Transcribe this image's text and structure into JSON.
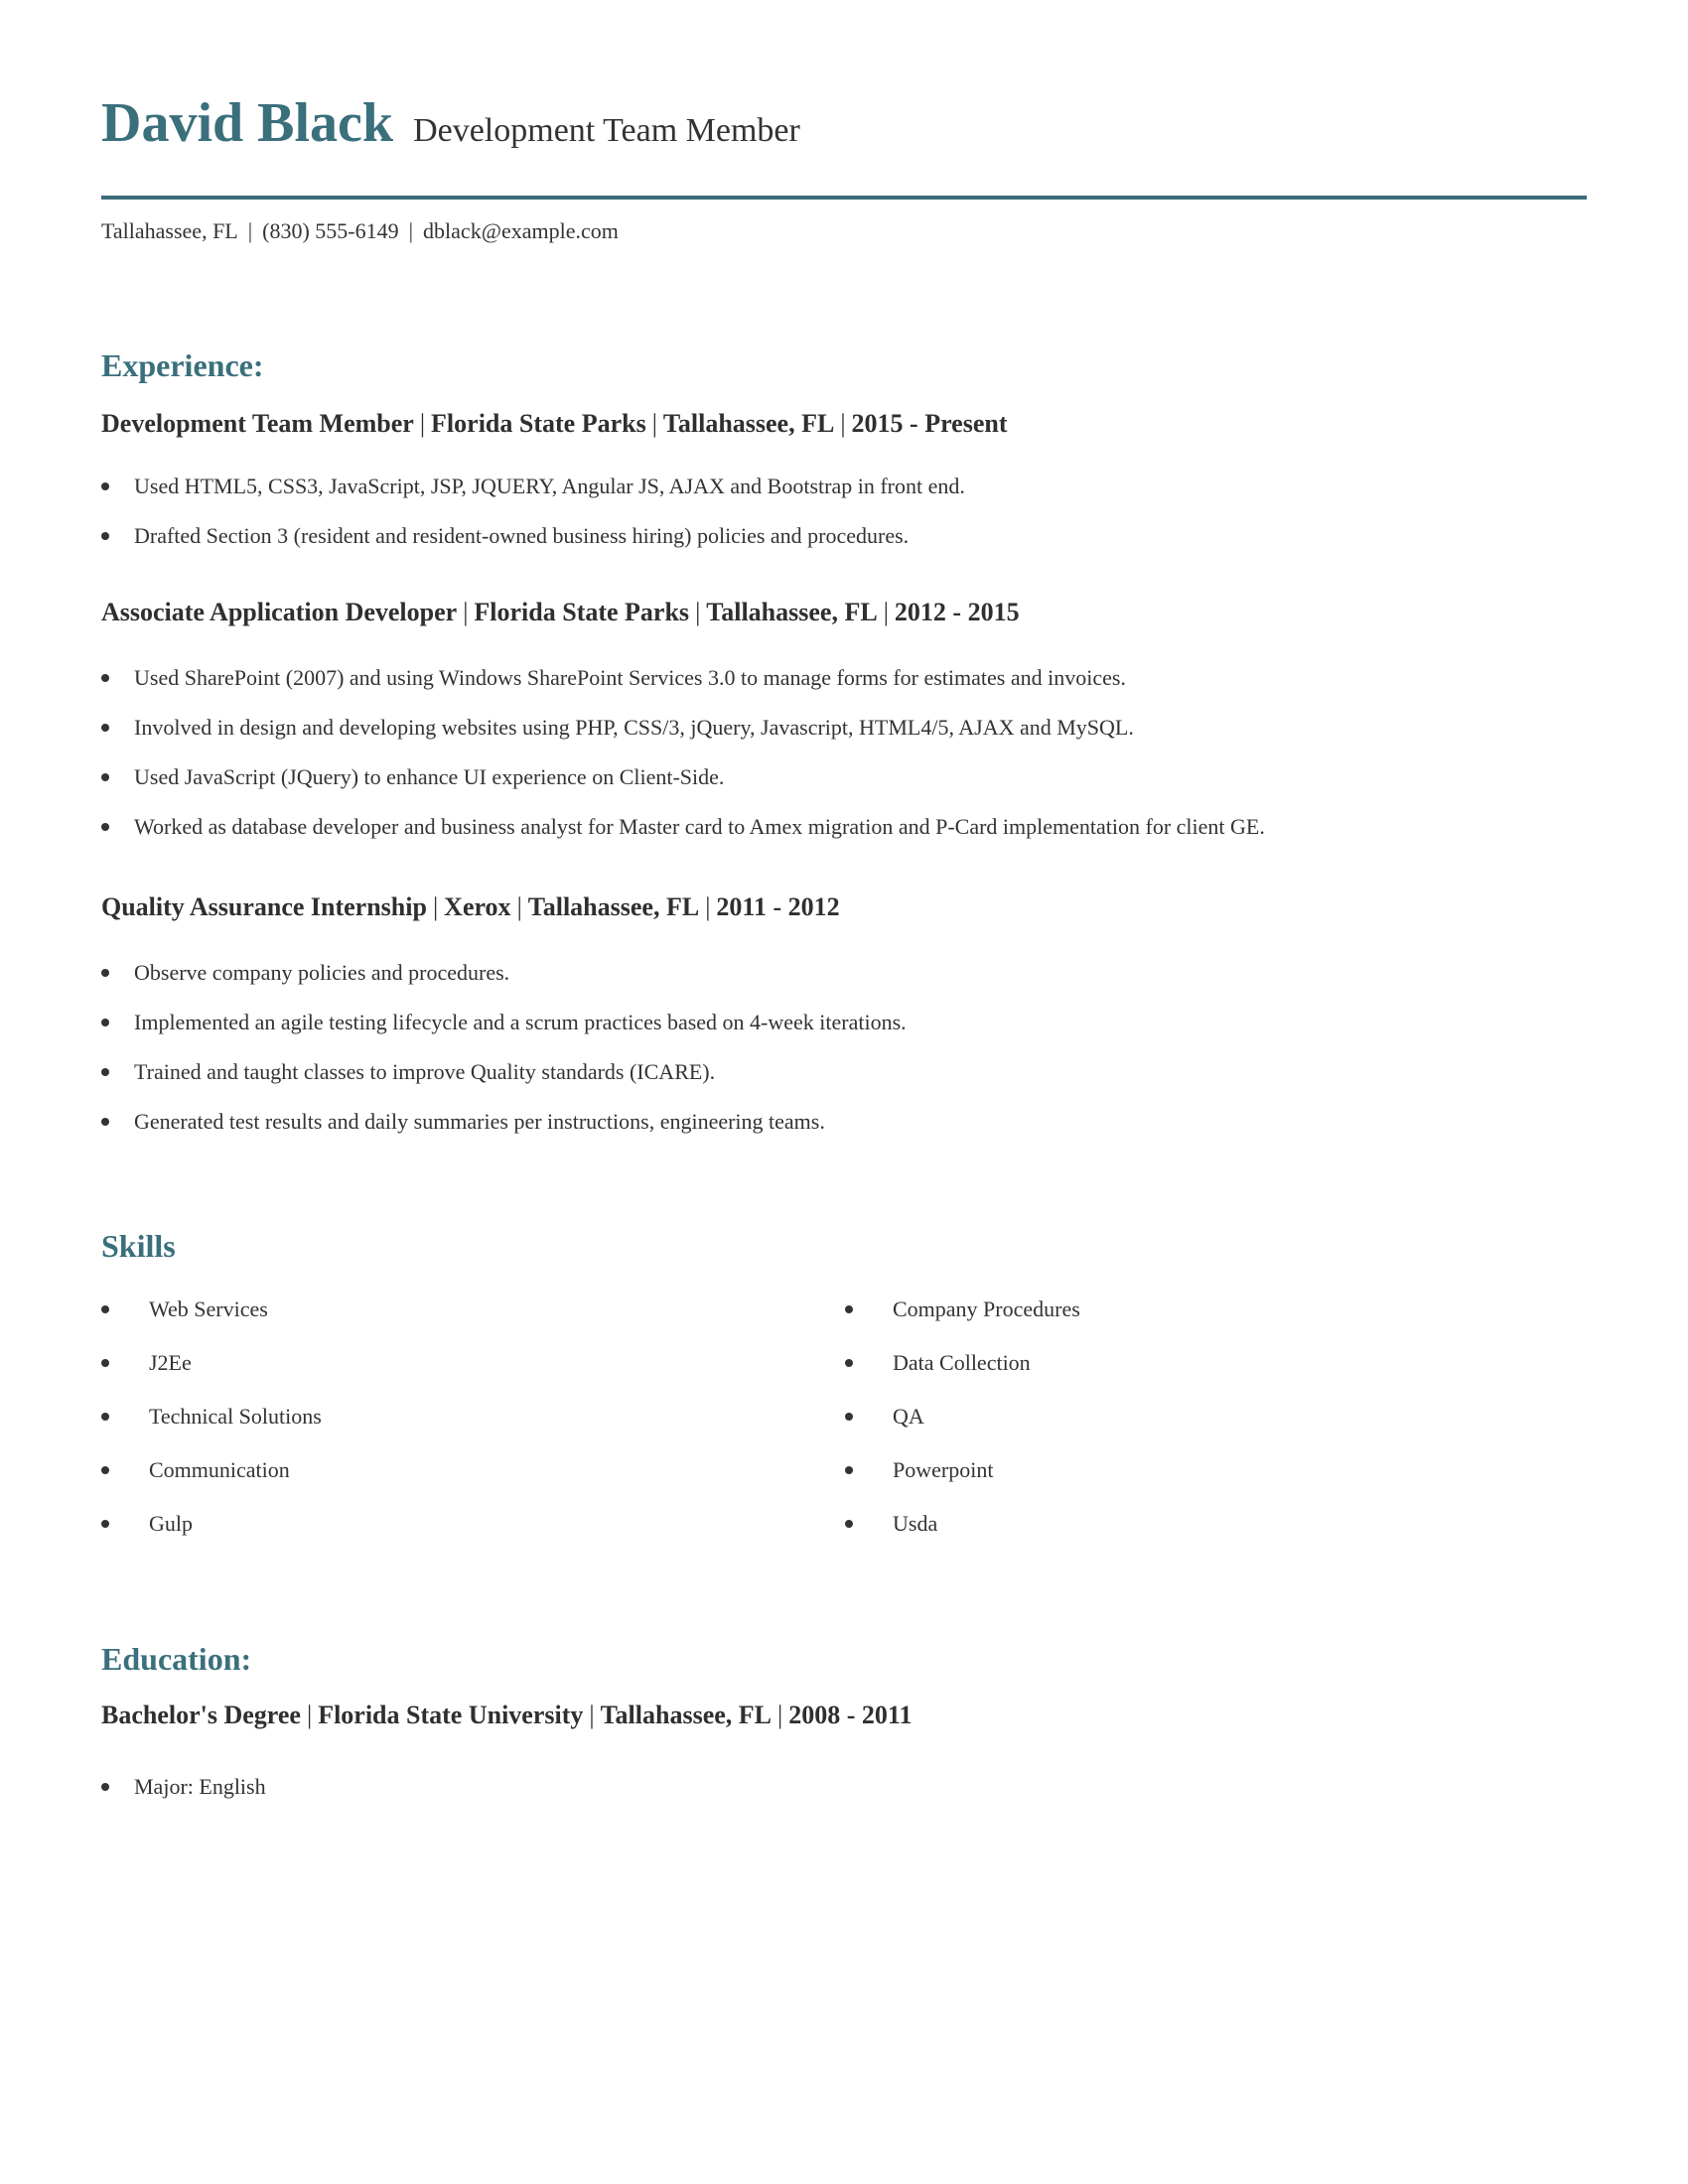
{
  "header": {
    "name": "David Black",
    "title": "Development Team Member"
  },
  "contact": {
    "location": "Tallahassee, FL",
    "phone": "(830) 555-6149",
    "email": "dblack@example.com",
    "separator": "|"
  },
  "experience": {
    "heading": "Experience:",
    "jobs": [
      {
        "role": "Development Team Member",
        "company": "Florida State Parks",
        "location": "Tallahassee, FL",
        "dates": "2015 - Present",
        "bullets": [
          "Used HTML5, CSS3, JavaScript, JSP, JQUERY, Angular JS, AJAX and Bootstrap in front end.",
          "Drafted Section 3 (resident and resident-owned business hiring) policies and procedures."
        ]
      },
      {
        "role": "Associate Application Developer",
        "company": "Florida State Parks",
        "location": "Tallahassee, FL",
        "dates": "2012 - 2015",
        "bullets": [
          "Used SharePoint (2007) and using Windows SharePoint Services 3.0 to manage forms for estimates and invoices.",
          "Involved in design and developing websites using PHP, CSS/3, jQuery, Javascript, HTML4/5, AJAX and MySQL.",
          "Used JavaScript (JQuery) to enhance UI experience on Client-Side.",
          "Worked as database developer and business analyst for Master card to Amex migration and P-Card implementation for client GE."
        ]
      },
      {
        "role": "Quality Assurance Internship",
        "company": "Xerox",
        "location": "Tallahassee, FL",
        "dates": "2011 - 2012",
        "bullets": [
          "Observe company policies and procedures.",
          "Implemented an agile testing lifecycle and a scrum practices based on 4-week iterations.",
          "Trained and taught classes to improve Quality standards (ICARE).",
          "Generated test results and daily summaries per instructions, engineering teams."
        ]
      }
    ]
  },
  "skills": {
    "heading": "Skills",
    "left": [
      "Web Services",
      "J2Ee",
      "Technical Solutions",
      "Communication",
      "Gulp"
    ],
    "right": [
      "Company Procedures",
      "Data Collection",
      "QA",
      "Powerpoint",
      "Usda"
    ]
  },
  "education": {
    "heading": "Education:",
    "entries": [
      {
        "degree": "Bachelor's Degree",
        "school": "Florida State University",
        "location": "Tallahassee, FL",
        "dates": "2008 - 2011",
        "bullets": [
          "Major: English"
        ]
      }
    ]
  },
  "colors": {
    "accent": "#3a6f7c",
    "text": "#333333"
  }
}
